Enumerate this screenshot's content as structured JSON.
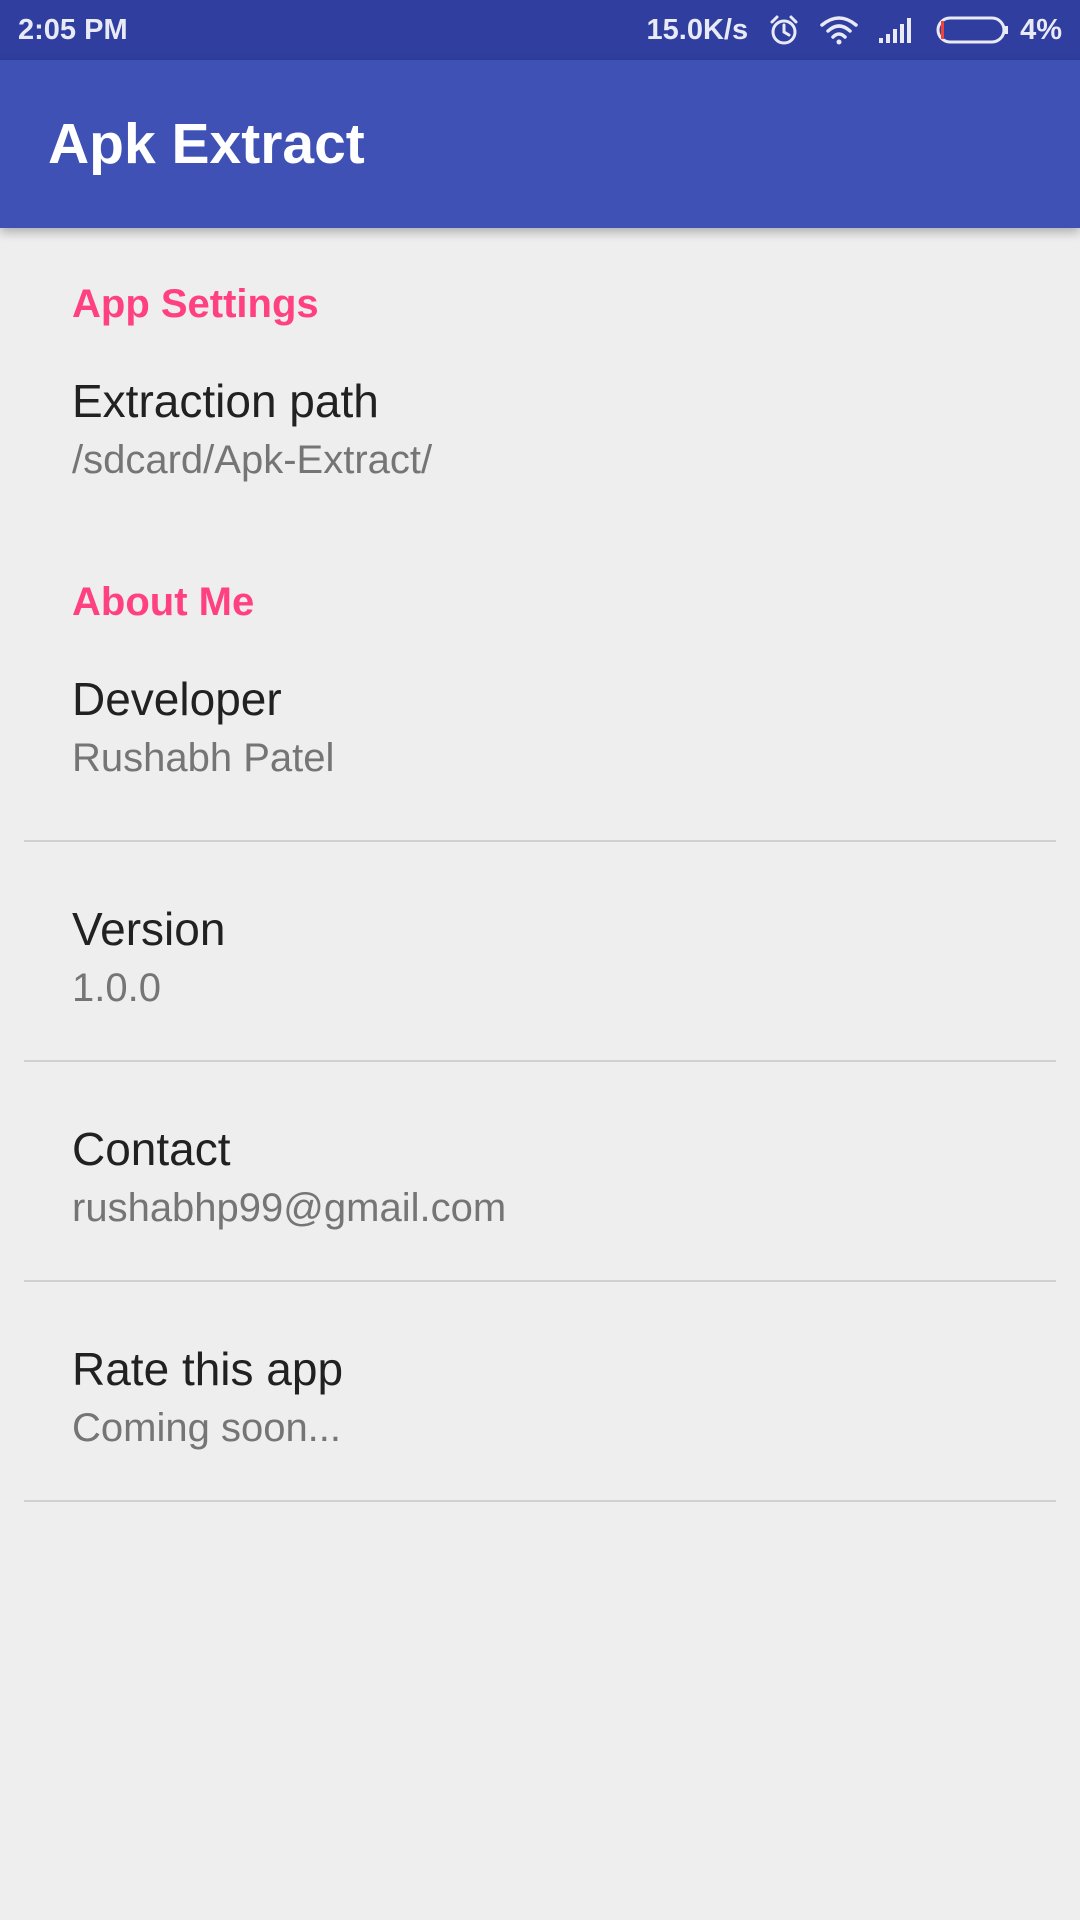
{
  "status_bar": {
    "time": "2:05 PM",
    "network_speed": "15.0K/s",
    "battery_percent": "4%",
    "icons": [
      "alarm-icon",
      "wifi-icon",
      "signal-icon",
      "battery-icon"
    ],
    "battery_level": 0.04
  },
  "app_bar": {
    "title": "Apk Extract",
    "color": "#3f51b5"
  },
  "sections": {
    "app_settings": {
      "header": "App Settings",
      "items": [
        {
          "title": "Extraction path",
          "summary": "/sdcard/Apk-Extract/"
        }
      ]
    },
    "about_me": {
      "header": "About Me",
      "items": [
        {
          "title": "Developer",
          "summary": "Rushabh Patel"
        },
        {
          "title": "Version",
          "summary": "1.0.0"
        },
        {
          "title": "Contact",
          "summary": "rushabhp99@gmail.com"
        },
        {
          "title": "Rate this app",
          "summary": "Coming soon..."
        }
      ]
    }
  },
  "colors": {
    "accent": "#ff4081",
    "primary_dark": "#303f9f",
    "background": "#eeeeee"
  }
}
